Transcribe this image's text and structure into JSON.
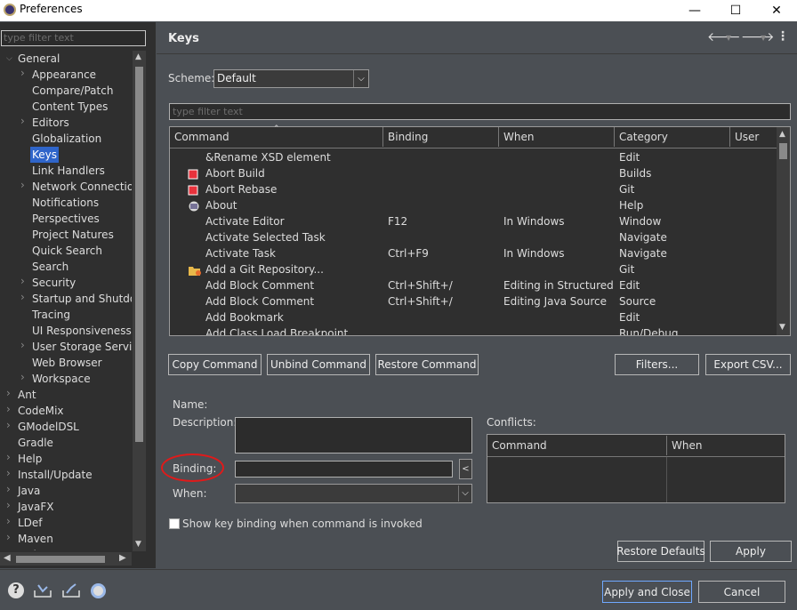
{
  "window": {
    "title": "Preferences",
    "minimize": "—",
    "maximize": "☐",
    "close": "✕"
  },
  "left": {
    "filter_placeholder": "type filter text",
    "tree": [
      {
        "label": "General",
        "expanded": true
      },
      {
        "label": "Appearance",
        "child": true,
        "arrow": true
      },
      {
        "label": "Compare/Patch",
        "child": true
      },
      {
        "label": "Content Types",
        "child": true
      },
      {
        "label": "Editors",
        "child": true,
        "arrow": true
      },
      {
        "label": "Globalization",
        "child": true
      },
      {
        "label": "Keys",
        "child": true,
        "selected": true
      },
      {
        "label": "Link Handlers",
        "child": true
      },
      {
        "label": "Network Connections",
        "child": true,
        "arrow": true
      },
      {
        "label": "Notifications",
        "child": true
      },
      {
        "label": "Perspectives",
        "child": true
      },
      {
        "label": "Project Natures",
        "child": true
      },
      {
        "label": "Quick Search",
        "child": true
      },
      {
        "label": "Search",
        "child": true
      },
      {
        "label": "Security",
        "child": true,
        "arrow": true
      },
      {
        "label": "Startup and Shutdown",
        "child": true,
        "arrow": true
      },
      {
        "label": "Tracing",
        "child": true
      },
      {
        "label": "UI Responsiveness Monitoring",
        "child": true
      },
      {
        "label": "User Storage Service",
        "child": true,
        "arrow": true
      },
      {
        "label": "Web Browser",
        "child": true
      },
      {
        "label": "Workspace",
        "child": true,
        "arrow": true
      },
      {
        "label": "Ant",
        "arrow": true
      },
      {
        "label": "CodeMix",
        "arrow": true
      },
      {
        "label": "GModelDSL",
        "arrow": true
      },
      {
        "label": "Gradle"
      },
      {
        "label": "Help",
        "arrow": true
      },
      {
        "label": "Install/Update",
        "arrow": true
      },
      {
        "label": "Java",
        "arrow": true
      },
      {
        "label": "JavaFX",
        "arrow": true
      },
      {
        "label": "LDef",
        "arrow": true
      },
      {
        "label": "Maven",
        "arrow": true
      },
      {
        "label": "Mylyn",
        "arrow": true
      }
    ]
  },
  "page": {
    "title": "Keys",
    "nav": {
      "back": "🡐",
      "forward": "🡒",
      "menu": "⋮"
    }
  },
  "scheme": {
    "label": "Scheme:",
    "value": "Default"
  },
  "keys_filter_placeholder": "type filter text",
  "table": {
    "headers": [
      "Command",
      "Binding",
      "When",
      "Category",
      "User"
    ],
    "rows": [
      {
        "command": "&Rename XSD element",
        "binding": "",
        "when": "",
        "category": "Edit",
        "icon": ""
      },
      {
        "command": "Abort Build",
        "binding": "",
        "when": "",
        "category": "Builds",
        "icon": "red"
      },
      {
        "command": "Abort Rebase",
        "binding": "",
        "when": "",
        "category": "Git",
        "icon": "red"
      },
      {
        "command": "About",
        "binding": "",
        "when": "",
        "category": "Help",
        "icon": "about"
      },
      {
        "command": "Activate Editor",
        "binding": "F12",
        "when": "In Windows",
        "category": "Window",
        "icon": ""
      },
      {
        "command": "Activate Selected Task",
        "binding": "",
        "when": "",
        "category": "Navigate",
        "icon": ""
      },
      {
        "command": "Activate Task",
        "binding": "Ctrl+F9",
        "when": "In Windows",
        "category": "Navigate",
        "icon": ""
      },
      {
        "command": "Add a Git Repository...",
        "binding": "",
        "when": "",
        "category": "Git",
        "icon": "folder"
      },
      {
        "command": "Add Block Comment",
        "binding": "Ctrl+Shift+/",
        "when": "Editing in Structured...",
        "category": "Edit",
        "icon": ""
      },
      {
        "command": "Add Block Comment",
        "binding": "Ctrl+Shift+/",
        "when": "Editing Java Source",
        "category": "Source",
        "icon": ""
      },
      {
        "command": "Add Bookmark",
        "binding": "",
        "when": "",
        "category": "Edit",
        "icon": ""
      },
      {
        "command": "Add Class Load Breakpoint",
        "binding": "",
        "when": "",
        "category": "Run/Debug",
        "icon": ""
      }
    ]
  },
  "buttons": {
    "copy": "Copy Command",
    "unbind": "Unbind Command",
    "restore": "Restore Command",
    "filters": "Filters...",
    "export": "Export CSV...",
    "restore_defaults": "Restore Defaults",
    "apply": "Apply",
    "apply_close": "Apply and Close",
    "cancel": "Cancel"
  },
  "details": {
    "name": "Name:",
    "description": "Description:",
    "binding": "Binding:",
    "when": "When:",
    "conflicts": "Conflicts:",
    "conflict_headers": [
      "Command",
      "When"
    ],
    "show_key": "Show key binding when command is invoked"
  },
  "colors": {
    "selected": "#2f65ca",
    "annotation": "#e01a1a"
  }
}
